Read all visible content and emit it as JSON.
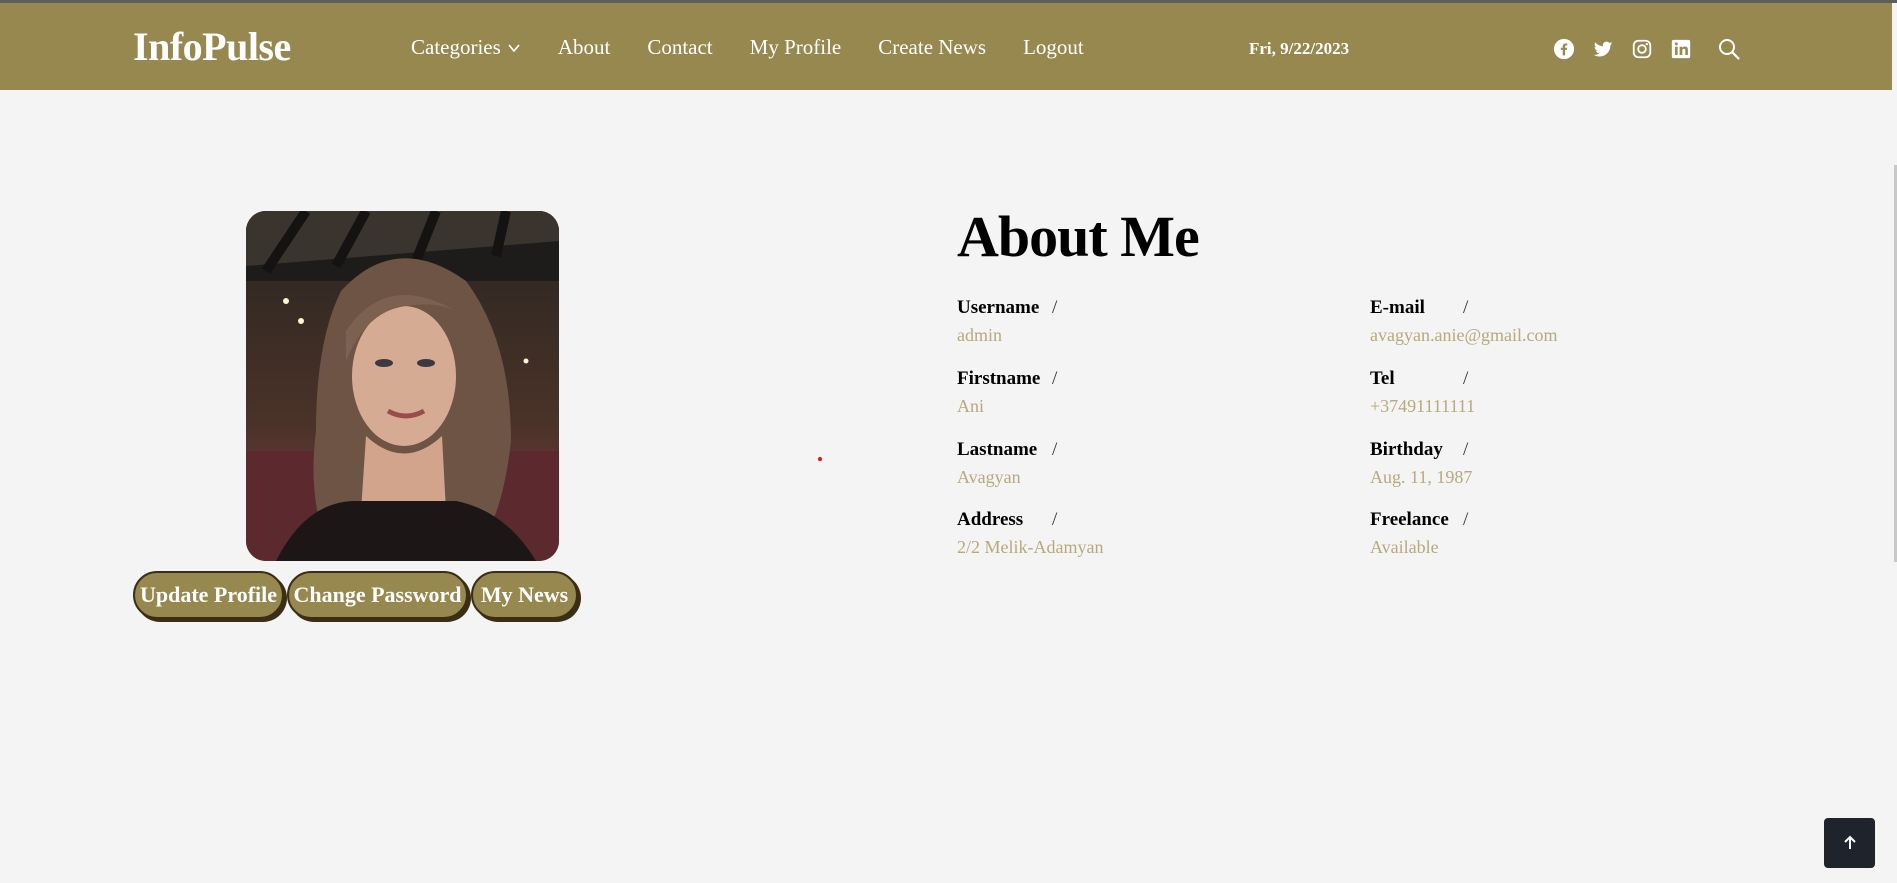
{
  "brand": "InfoPulse",
  "nav": {
    "categories": "Categories",
    "about": "About",
    "contact": "Contact",
    "my_profile": "My Profile",
    "create_news": "Create News",
    "logout": "Logout"
  },
  "date": "Fri, 9/22/2023",
  "social_icons": [
    "facebook-icon",
    "twitter-icon",
    "instagram-icon",
    "linkedin-icon",
    "search-icon"
  ],
  "profile": {
    "buttons": {
      "update": "Update Profile",
      "password": "Change Password",
      "news": "My News"
    }
  },
  "about": {
    "title": "About Me",
    "fields": {
      "username": {
        "label": "Username",
        "value": "admin"
      },
      "firstname": {
        "label": "Firstname",
        "value": "Ani"
      },
      "lastname": {
        "label": "Lastname",
        "value": "Avagyan"
      },
      "address": {
        "label": "Address",
        "value": "2/2 Melik-Adamyan"
      },
      "email": {
        "label": "E-mail",
        "value": "avagyan.anie@gmail.com"
      },
      "tel": {
        "label": "Tel",
        "value": "+37491111111"
      },
      "birthday": {
        "label": "Birthday",
        "value": "Aug. 11, 1987"
      },
      "freelance": {
        "label": "Freelance",
        "value": "Available"
      }
    },
    "separator": "/"
  },
  "colors": {
    "navbar": "#978850",
    "value_text": "#b8a87b",
    "button_shadow": "#3a2f16",
    "back_to_top": "#1f232b"
  }
}
